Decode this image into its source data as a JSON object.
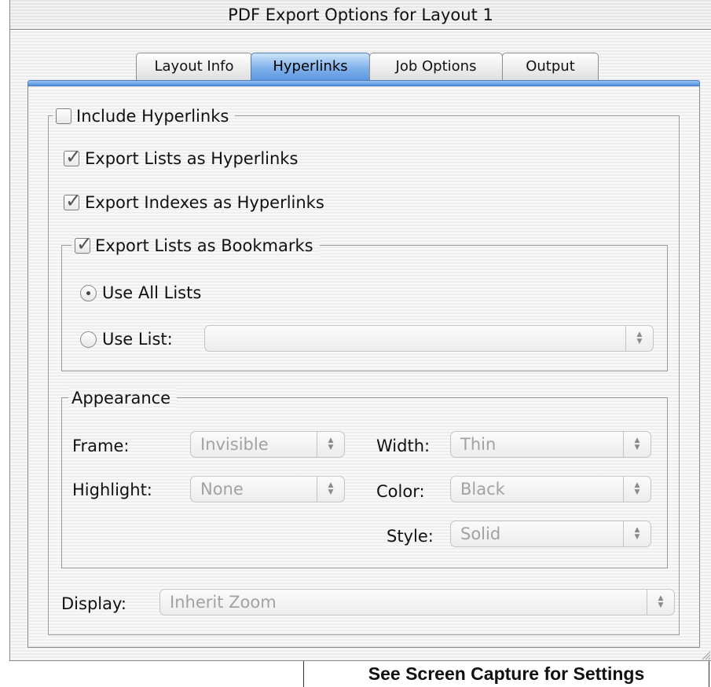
{
  "window": {
    "title": "PDF Export Options for Layout 1"
  },
  "tabs": [
    {
      "label": "Layout Info",
      "active": false
    },
    {
      "label": "Hyperlinks",
      "active": true
    },
    {
      "label": "Job Options",
      "active": false
    },
    {
      "label": "Output",
      "active": false
    }
  ],
  "hyperlinks": {
    "include_hyperlinks": {
      "label": "Include Hyperlinks",
      "checked": false
    },
    "export_lists": {
      "label": "Export Lists as Hyperlinks",
      "checked": true
    },
    "export_indexes": {
      "label": "Export Indexes as Hyperlinks",
      "checked": true
    },
    "bookmarks": {
      "label": "Export Lists as Bookmarks",
      "checked": true,
      "use_all_lists": {
        "label": "Use All Lists",
        "selected": true
      },
      "use_list": {
        "label": "Use List:",
        "selected": false,
        "value": ""
      }
    }
  },
  "appearance": {
    "legend": "Appearance",
    "frame": {
      "label": "Frame:",
      "value": "Invisible"
    },
    "highlight": {
      "label": "Highlight:",
      "value": "None"
    },
    "width": {
      "label": "Width:",
      "value": "Thin"
    },
    "color": {
      "label": "Color:",
      "value": "Black"
    },
    "style": {
      "label": "Style:",
      "value": "Solid"
    }
  },
  "display": {
    "label": "Display:",
    "value": "Inherit Zoom"
  },
  "caption": "See Screen Capture for Settings",
  "colors": {
    "tab_active": "#6aa0e6",
    "text_disabled": "#9a9a9a"
  }
}
